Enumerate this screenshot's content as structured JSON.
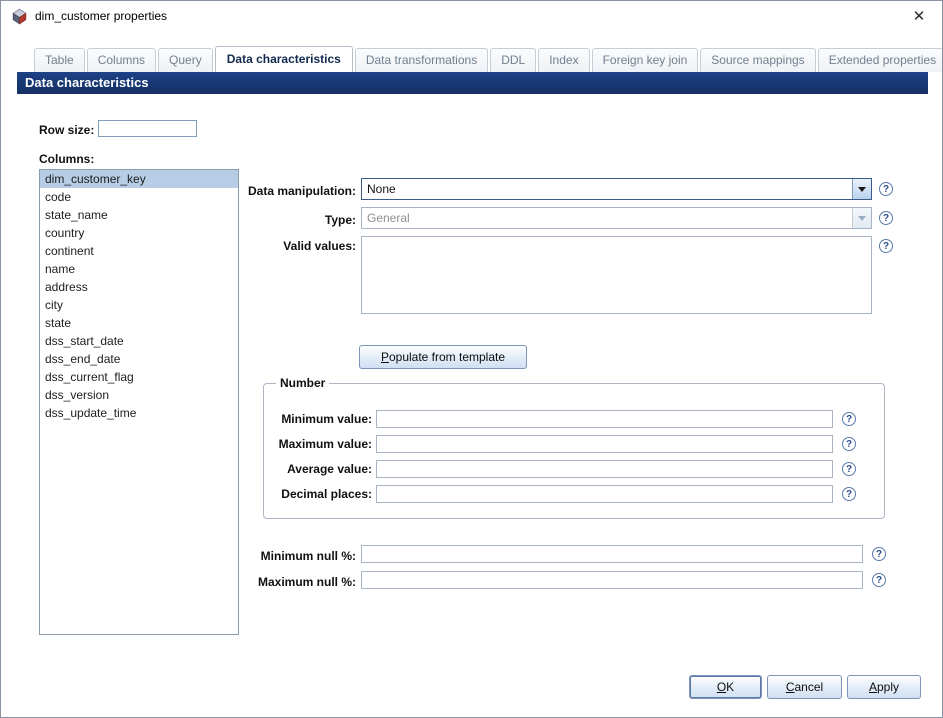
{
  "window": {
    "title": "dim_customer properties"
  },
  "icons": {
    "help": "?",
    "close": "✕"
  },
  "tabs": [
    {
      "label": "Table",
      "active": false
    },
    {
      "label": "Columns",
      "active": false
    },
    {
      "label": "Query",
      "active": false
    },
    {
      "label": "Data characteristics",
      "active": true
    },
    {
      "label": "Data transformations",
      "active": false
    },
    {
      "label": "DDL",
      "active": false
    },
    {
      "label": "Index",
      "active": false
    },
    {
      "label": "Foreign key join",
      "active": false
    },
    {
      "label": "Source mappings",
      "active": false
    },
    {
      "label": "Extended properties",
      "active": false
    }
  ],
  "header": {
    "title": "Data characteristics"
  },
  "row_size": {
    "label": "Row size:",
    "value": ""
  },
  "columns": {
    "label": "Columns:",
    "selected": "dim_customer_key",
    "items": [
      "dim_customer_key",
      "code",
      "state_name",
      "country",
      "continent",
      "name",
      "address",
      "city",
      "state",
      "dss_start_date",
      "dss_end_date",
      "dss_current_flag",
      "dss_version",
      "dss_update_time"
    ]
  },
  "fields": {
    "data_manipulation": {
      "label": "Data manipulation:",
      "value": "None"
    },
    "type": {
      "label": "Type:",
      "value": "General"
    },
    "valid_values": {
      "label": "Valid values:",
      "value": ""
    },
    "min_null": {
      "label": "Minimum null %:",
      "value": ""
    },
    "max_null": {
      "label": "Maximum null %:",
      "value": ""
    }
  },
  "populate_button": {
    "u": "P",
    "rest": "opulate from template"
  },
  "number_group": {
    "title": "Number",
    "fields": [
      {
        "label": "Minimum value:",
        "value": ""
      },
      {
        "label": "Maximum value:",
        "value": ""
      },
      {
        "label": "Average value:",
        "value": ""
      },
      {
        "label": "Decimal places:",
        "value": ""
      }
    ]
  },
  "footer": {
    "ok": {
      "u": "O",
      "rest": "K"
    },
    "cancel": {
      "u": "C",
      "rest": "ancel"
    },
    "apply": {
      "u": "A",
      "rest": "pply"
    }
  },
  "colors": {
    "header_bg": "#17397a",
    "selection_bg": "#b7cde6",
    "button_border": "#7e94b8"
  }
}
